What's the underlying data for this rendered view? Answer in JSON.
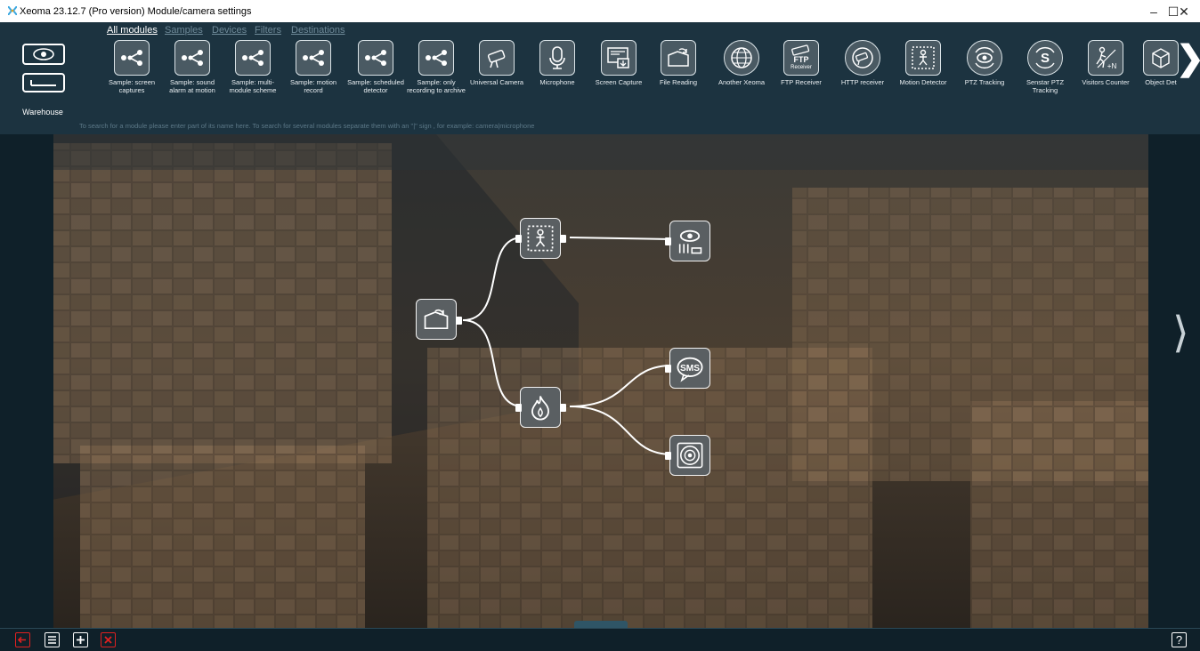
{
  "window": {
    "title": "Xeoma 23.12.7 (Pro version) Module/camera settings",
    "controls": {
      "minimize": "–",
      "maximize": "☐",
      "close": "✕"
    }
  },
  "tabs": [
    {
      "label": "All modules",
      "active": true
    },
    {
      "label": "Samples"
    },
    {
      "label": "Devices"
    },
    {
      "label": "Filters"
    },
    {
      "label": "Destinations"
    }
  ],
  "sidebar": {
    "label": "Warehouse"
  },
  "modules": [
    {
      "label": "Sample: screen captures",
      "icon": "sample-scheme-icon"
    },
    {
      "label": "Sample: sound alarm at motion",
      "icon": "sample-scheme-icon"
    },
    {
      "label": "Sample: multi-module scheme",
      "icon": "sample-scheme-icon"
    },
    {
      "label": "Sample: motion record",
      "icon": "sample-scheme-icon"
    },
    {
      "label": "Sample: scheduled detector",
      "icon": "sample-scheme-icon"
    },
    {
      "label": "Sample: only recording to archive",
      "icon": "sample-scheme-icon"
    },
    {
      "label": "Universal Camera",
      "icon": "camera-icon"
    },
    {
      "label": "Microphone",
      "icon": "microphone-icon"
    },
    {
      "label": "Screen Capture",
      "icon": "screen-capture-icon"
    },
    {
      "label": "File Reading",
      "icon": "file-reading-icon"
    },
    {
      "label": "Another Xeoma",
      "icon": "globe-icon"
    },
    {
      "label": "FTP Receiver",
      "icon": "ftp-receiver-icon",
      "badge": "FTP",
      "badge_sub": "Receiver"
    },
    {
      "label": "HTTP receiver",
      "icon": "http-receiver-icon"
    },
    {
      "label": "Motion Detector",
      "icon": "motion-detector-icon"
    },
    {
      "label": "PTZ Tracking",
      "icon": "ptz-tracking-icon"
    },
    {
      "label": "Senstar PTZ Tracking",
      "icon": "senstar-ptz-icon",
      "glyph": "S"
    },
    {
      "label": "Visitors Counter",
      "icon": "visitors-counter-icon",
      "glyph": "+N"
    },
    {
      "label": "Object Det",
      "icon": "object-detector-icon"
    }
  ],
  "hint": "To search for a module please enter part of its name here. To search for several modules separate them with an \"|\" sign , for example: camera|microphone",
  "scheme": {
    "nodes": [
      {
        "name": "file-reading-node",
        "icon": "file-reading-icon"
      },
      {
        "name": "motion-detector-node",
        "icon": "motion-detector-icon"
      },
      {
        "name": "fire-detector-node",
        "icon": "fire-icon"
      },
      {
        "name": "preview-archive-node",
        "icon": "preview-archive-icon"
      },
      {
        "name": "sms-node",
        "icon": "sms-icon",
        "text": "SMS"
      },
      {
        "name": "sound-alarm-node",
        "icon": "speaker-icon"
      }
    ]
  },
  "bottom_bar": {
    "buttons": [
      "exit-icon",
      "list-icon",
      "add-icon",
      "delete-icon"
    ],
    "help": "?"
  },
  "colors": {
    "accent_red": "#e02020",
    "panel": "#1c3340",
    "active_tab": "#ffffff",
    "inactive_tab": "#6f8a99"
  }
}
